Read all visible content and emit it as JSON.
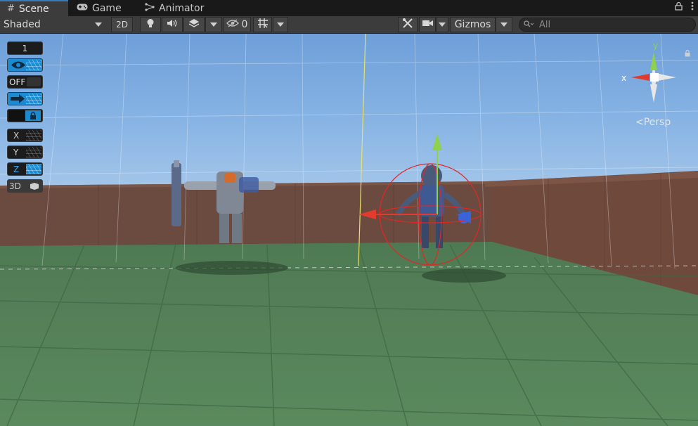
{
  "tabs": [
    {
      "label": "Scene",
      "icon": "grid-icon",
      "active": true
    },
    {
      "label": "Game",
      "icon": "gamepad-icon",
      "active": false
    },
    {
      "label": "Animator",
      "icon": "animator-icon",
      "active": false
    }
  ],
  "toolbar": {
    "draw_mode": "Shaded",
    "mode_2d": "2D",
    "hidden_count": "0",
    "gizmos_label": "Gizmos",
    "search_placeholder": "All"
  },
  "left_tools": {
    "count_label": "1",
    "off_label": "OFF",
    "x_label": "X",
    "y_label": "Y",
    "z_label": "Z",
    "three_d_label": "3D"
  },
  "scene_gizmo": {
    "y_label": "y",
    "x_label": "x",
    "projection_label": "Persp"
  },
  "colors": {
    "accent": "#3a79bb",
    "x_axis": "#e23a2c",
    "y_axis": "#8fd14a",
    "z_axis": "#3a63d9",
    "tool_blue": "#1a8bd1"
  }
}
